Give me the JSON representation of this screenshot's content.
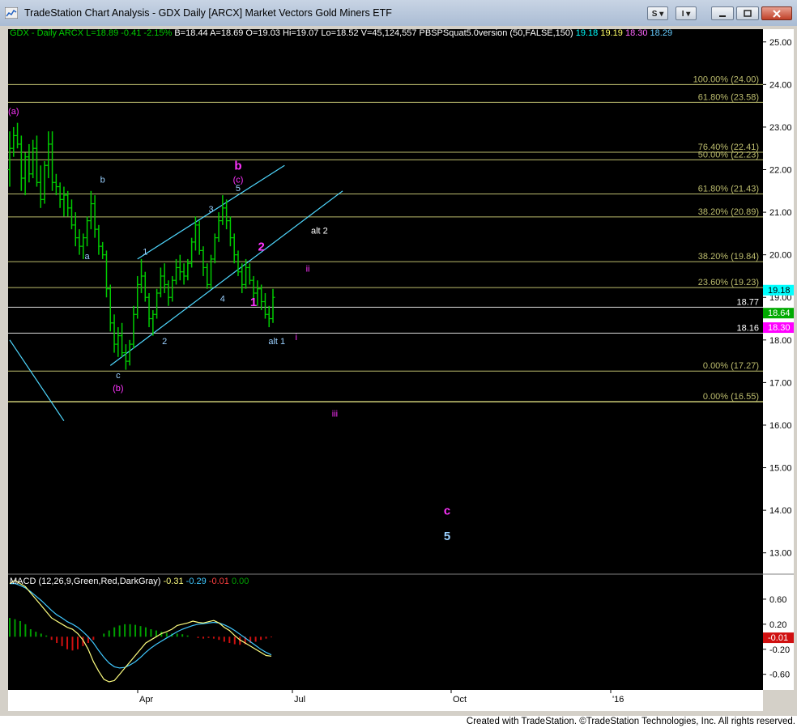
{
  "window": {
    "title": "TradeStation Chart Analysis - GDX Daily [ARCX] Market Vectors Gold Miners ETF",
    "buttons": {
      "s": "S",
      "i": "I"
    },
    "footer": "Created with TradeStation. ©TradeStation Technologies, Inc. All rights reserved."
  },
  "header": {
    "symbol": "GDX - Daily",
    "exchange": "ARCX",
    "last": "L=18.89",
    "change": "-0.41",
    "change_pct": "-2.15%",
    "bid": "B=18.44",
    "ask": "A=18.69",
    "open": "O=19.03",
    "high": "Hi=19.07",
    "low": "Lo=18.52",
    "volume": "V=45,124,557",
    "indicator": "PBSPSquat5.0version (50,FALSE,150)",
    "ind_values": [
      "19.18",
      "19.19",
      "18.30",
      "18.29"
    ]
  },
  "colors": {
    "background": "#000000",
    "up": "#00cc00",
    "down": "#00cc00",
    "fib": "#bdbd6e",
    "label_white": "#ffffff",
    "label_magenta": "#ff33ff",
    "channel": "#4fd8ff",
    "macd": "#ffff80",
    "signal": "#40c8ff",
    "hist_pos": "#00a000",
    "hist_neg": "#d01010",
    "accent_cyan": "#00ffff",
    "accent_green": "#00aa00",
    "accent_magenta": "#ff00ff"
  },
  "chart_data": {
    "type": "ohlc",
    "symbol": "GDX",
    "x_ticks": [
      "Apr",
      "Jul",
      "Oct",
      "'16"
    ],
    "y_ticks": [
      13.0,
      14.0,
      15.0,
      16.0,
      17.0,
      18.0,
      19.0,
      20.0,
      21.0,
      22.0,
      23.0,
      24.0,
      25.0
    ],
    "ylim": [
      12.5,
      25.3
    ],
    "series": [
      {
        "name": "GDX",
        "values": [
          [
            22.0,
            22.9,
            21.6,
            22.5
          ],
          [
            22.5,
            23.0,
            22.3,
            22.8
          ],
          [
            22.8,
            23.1,
            22.5,
            22.6
          ],
          [
            22.6,
            22.8,
            21.5,
            21.8
          ],
          [
            21.8,
            22.4,
            21.4,
            22.3
          ],
          [
            22.3,
            22.6,
            21.7,
            21.9
          ],
          [
            21.9,
            22.7,
            21.8,
            22.5
          ],
          [
            22.5,
            22.8,
            21.6,
            21.7
          ],
          [
            21.7,
            22.1,
            21.1,
            21.3
          ],
          [
            21.3,
            22.2,
            21.2,
            22.1
          ],
          [
            22.1,
            22.9,
            21.8,
            22.6
          ],
          [
            22.6,
            22.9,
            21.5,
            21.7
          ],
          [
            21.7,
            21.9,
            21.4,
            21.6
          ],
          [
            21.6,
            21.7,
            21.1,
            21.3
          ],
          [
            21.3,
            21.6,
            20.9,
            21.4
          ],
          [
            21.4,
            21.5,
            20.9,
            21.1
          ],
          [
            21.1,
            21.3,
            20.6,
            20.7
          ],
          [
            20.7,
            21.0,
            20.2,
            20.4
          ],
          [
            20.4,
            20.6,
            20.0,
            20.2
          ],
          [
            20.2,
            20.5,
            19.9,
            20.4
          ],
          [
            20.4,
            20.9,
            20.2,
            20.8
          ],
          [
            20.8,
            21.5,
            20.6,
            21.2
          ],
          [
            21.2,
            21.4,
            20.4,
            20.6
          ],
          [
            20.6,
            20.7,
            20.0,
            20.2
          ],
          [
            20.2,
            20.3,
            19.9,
            20.0
          ],
          [
            20.0,
            20.1,
            19.0,
            19.2
          ],
          [
            19.2,
            19.3,
            18.2,
            18.4
          ],
          [
            18.4,
            18.6,
            17.7,
            17.9
          ],
          [
            17.9,
            18.3,
            17.6,
            18.1
          ],
          [
            18.1,
            18.4,
            17.6,
            17.7
          ],
          [
            17.7,
            17.9,
            17.3,
            17.5
          ],
          [
            17.5,
            18.0,
            17.4,
            17.9
          ],
          [
            17.9,
            18.8,
            17.8,
            18.6
          ],
          [
            18.6,
            19.5,
            18.5,
            19.3
          ],
          [
            19.3,
            19.9,
            19.1,
            19.5
          ],
          [
            19.5,
            19.6,
            18.9,
            19.0
          ],
          [
            19.0,
            19.1,
            18.3,
            18.5
          ],
          [
            18.5,
            18.7,
            18.1,
            18.6
          ],
          [
            18.6,
            19.2,
            18.5,
            19.1
          ],
          [
            19.1,
            19.7,
            19.0,
            19.5
          ],
          [
            19.5,
            19.8,
            19.1,
            19.3
          ],
          [
            19.3,
            19.4,
            18.8,
            19.0
          ],
          [
            19.0,
            19.5,
            18.9,
            19.4
          ],
          [
            19.4,
            19.9,
            19.3,
            19.7
          ],
          [
            19.7,
            20.0,
            19.4,
            19.6
          ],
          [
            19.6,
            19.8,
            19.3,
            19.5
          ],
          [
            19.5,
            19.9,
            19.4,
            19.8
          ],
          [
            19.8,
            20.4,
            19.7,
            20.3
          ],
          [
            20.3,
            20.9,
            20.1,
            20.7
          ],
          [
            20.7,
            20.8,
            20.0,
            20.1
          ],
          [
            20.1,
            20.2,
            19.5,
            19.7
          ],
          [
            19.7,
            19.8,
            19.2,
            19.3
          ],
          [
            19.3,
            20.0,
            19.2,
            19.9
          ],
          [
            19.9,
            20.5,
            19.8,
            20.4
          ],
          [
            20.4,
            21.0,
            20.3,
            20.8
          ],
          [
            20.8,
            21.4,
            20.7,
            21.1
          ],
          [
            21.1,
            21.3,
            20.6,
            20.8
          ],
          [
            20.8,
            20.9,
            20.2,
            20.4
          ],
          [
            20.4,
            20.5,
            19.8,
            20.0
          ],
          [
            20.0,
            20.1,
            19.5,
            19.6
          ],
          [
            19.6,
            19.8,
            19.1,
            19.3
          ],
          [
            19.3,
            19.9,
            19.2,
            19.7
          ],
          [
            19.7,
            19.8,
            19.3,
            19.4
          ],
          [
            19.4,
            19.5,
            18.9,
            19.1
          ],
          [
            19.1,
            19.4,
            18.8,
            19.2
          ],
          [
            19.2,
            19.3,
            18.7,
            18.9
          ],
          [
            18.9,
            19.1,
            18.5,
            18.6
          ],
          [
            18.6,
            18.8,
            18.3,
            18.5
          ],
          [
            18.5,
            19.2,
            18.4,
            19.0
          ]
        ]
      }
    ],
    "levels": [
      {
        "label": "100.00% (24.00)",
        "value": 24.0
      },
      {
        "label": "61.80% (23.58)",
        "value": 23.58
      },
      {
        "label": "76.40% (22.41)",
        "value": 22.41
      },
      {
        "label": "50.00% (22.23)",
        "value": 22.23
      },
      {
        "label": "61.80% (21.43)",
        "value": 21.43
      },
      {
        "label": "38.20% (20.89)",
        "value": 20.89
      },
      {
        "label": "38.20% (19.84)",
        "value": 19.84
      },
      {
        "label": "23.60% (19.23)",
        "value": 19.23
      },
      {
        "label": "18.77",
        "value": 18.77
      },
      {
        "label": "18.16",
        "value": 18.16
      },
      {
        "label": "0.00% (17.27)",
        "value": 17.27
      },
      {
        "label": "0.00% (16.55)",
        "value": 16.55
      }
    ],
    "price_tags": [
      {
        "label": "19.18",
        "value": 19.18,
        "color": "#00ffff"
      },
      {
        "label": "18.64",
        "value": 18.64,
        "color": "#00aa00"
      },
      {
        "label": "18.30",
        "value": 18.3,
        "color": "#ff00ff"
      }
    ],
    "annotations": [
      {
        "text": "(a)",
        "bar": 1,
        "value": 23.3,
        "color": "#ff33ff"
      },
      {
        "text": "b",
        "bar": 24,
        "value": 21.7,
        "color": "#9ad0ff"
      },
      {
        "text": "a",
        "bar": 20,
        "value": 19.9,
        "color": "#9ad0ff"
      },
      {
        "text": "c",
        "bar": 28,
        "value": 17.1,
        "color": "#9ad0ff"
      },
      {
        "text": "(b)",
        "bar": 28,
        "value": 16.8,
        "color": "#ff33ff"
      },
      {
        "text": "1",
        "bar": 35,
        "value": 20.0,
        "color": "#9ad0ff"
      },
      {
        "text": "2",
        "bar": 40,
        "value": 17.9,
        "color": "#9ad0ff"
      },
      {
        "text": "3",
        "bar": 52,
        "value": 21.0,
        "color": "#9ad0ff"
      },
      {
        "text": "4",
        "bar": 55,
        "value": 18.9,
        "color": "#9ad0ff"
      },
      {
        "text": "5",
        "bar": 59,
        "value": 21.5,
        "color": "#9ad0ff"
      },
      {
        "text": "(c)",
        "bar": 59,
        "value": 21.7,
        "color": "#ff33ff"
      },
      {
        "text": "b",
        "bar": 59,
        "value": 22.0,
        "color": "#ff33ff",
        "big": true
      },
      {
        "text": "2",
        "bar": 65,
        "value": 20.1,
        "color": "#ff33ff",
        "big": true
      },
      {
        "text": "1",
        "bar": 63,
        "value": 18.8,
        "color": "#ff33ff",
        "big": true
      },
      {
        "text": "alt 2",
        "bar": 80,
        "value": 20.5,
        "color": "#ffffff"
      },
      {
        "text": "ii",
        "bar": 77,
        "value": 19.6,
        "color": "#ff33ff"
      },
      {
        "text": "alt 1",
        "bar": 69,
        "value": 17.9,
        "color": "#9ad0ff"
      },
      {
        "text": "i",
        "bar": 74,
        "value": 18.0,
        "color": "#ff33ff"
      },
      {
        "text": "iii",
        "bar": 84,
        "value": 16.2,
        "color": "#ff33ff"
      },
      {
        "text": "c",
        "bar": 113,
        "value": 13.9,
        "color": "#ff33ff",
        "big": true
      },
      {
        "text": "5",
        "bar": 113,
        "value": 13.3,
        "color": "#9ad0ff",
        "big": true
      }
    ],
    "trendlines": [
      {
        "from": [
          0,
          18.0
        ],
        "to": [
          14,
          16.1
        ],
        "color": "#4fd8ff"
      },
      {
        "from": [
          33,
          19.9
        ],
        "to": [
          71,
          22.1
        ],
        "color": "#4fd8ff"
      },
      {
        "from": [
          26,
          17.4
        ],
        "to": [
          86,
          21.5
        ],
        "color": "#4fd8ff"
      }
    ]
  },
  "macd": {
    "label": "MACD (12,26,9,Green,Red,DarkGray)",
    "values": [
      "-0.31",
      "-0.29",
      "-0.01",
      "0.00"
    ],
    "value_colors": [
      "#ffff80",
      "#40c8ff",
      "#ff4040",
      "#00a000"
    ],
    "y_ticks": [
      0.6,
      0.2,
      -0.2,
      -0.6
    ],
    "ylim": [
      -0.85,
      1.0
    ],
    "last_tag": {
      "label": "-0.01",
      "value": -0.01
    },
    "macd_line": [
      0.85,
      0.9,
      0.85,
      0.8,
      0.7,
      0.6,
      0.5,
      0.4,
      0.3,
      0.25,
      0.2,
      0.15,
      0.12,
      0.05,
      -0.05,
      -0.2,
      -0.4,
      -0.55,
      -0.68,
      -0.72,
      -0.7,
      -0.6,
      -0.5,
      -0.4,
      -0.3,
      -0.2,
      -0.1,
      -0.05,
      0.0,
      0.05,
      0.08,
      0.12,
      0.18,
      0.2,
      0.22,
      0.25,
      0.23,
      0.22,
      0.24,
      0.26,
      0.22,
      0.15,
      0.1,
      0.02,
      -0.05,
      -0.1,
      -0.15,
      -0.2,
      -0.25,
      -0.3,
      -0.31
    ],
    "signal_line": [
      0.85,
      0.85,
      0.82,
      0.78,
      0.72,
      0.65,
      0.58,
      0.5,
      0.42,
      0.35,
      0.3,
      0.24,
      0.2,
      0.15,
      0.08,
      0.0,
      -0.1,
      -0.22,
      -0.33,
      -0.42,
      -0.48,
      -0.5,
      -0.49,
      -0.45,
      -0.4,
      -0.33,
      -0.25,
      -0.18,
      -0.12,
      -0.07,
      -0.02,
      0.03,
      0.08,
      0.12,
      0.15,
      0.18,
      0.2,
      0.21,
      0.22,
      0.23,
      0.22,
      0.19,
      0.15,
      0.1,
      0.04,
      -0.02,
      -0.08,
      -0.14,
      -0.2,
      -0.25,
      -0.29
    ],
    "hist": [
      0.3,
      0.28,
      0.25,
      0.2,
      0.12,
      0.08,
      0.05,
      0.02,
      -0.05,
      -0.1,
      -0.15,
      -0.2,
      -0.22,
      -0.2,
      -0.15,
      -0.1,
      -0.05,
      0.0,
      0.05,
      0.1,
      0.15,
      0.18,
      0.2,
      0.2,
      0.19,
      0.17,
      0.15,
      0.12,
      0.1,
      0.08,
      0.06,
      0.05,
      0.05,
      0.04,
      0.02,
      0.0,
      -0.02,
      -0.03,
      -0.02,
      -0.03,
      -0.05,
      -0.08,
      -0.1,
      -0.12,
      -0.13,
      -0.12,
      -0.1,
      -0.08,
      -0.05,
      -0.03,
      -0.01
    ]
  }
}
